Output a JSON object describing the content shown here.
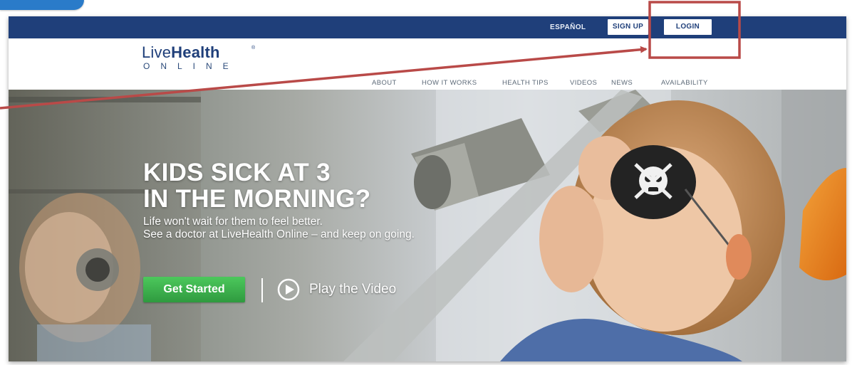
{
  "utility": {
    "espanol": "ESPAÑOL",
    "signup": "SIGN UP",
    "login": "LOGIN"
  },
  "logo": {
    "live": "Live",
    "health": "Health",
    "online": "ONLINE",
    "tm": "®"
  },
  "nav": {
    "items": [
      {
        "label": "ABOUT"
      },
      {
        "label": "HOW IT WORKS"
      },
      {
        "label": "HEALTH TIPS"
      },
      {
        "label": "VIDEOS"
      },
      {
        "label": "NEWS"
      },
      {
        "label": "AVAILABILITY"
      }
    ]
  },
  "hero": {
    "headline_line1": "KIDS SICK AT 3",
    "headline_line2": "IN THE MORNING?",
    "subline1": "Life won't wait for them to feel better.",
    "subline2": "See a doctor at LiveHealth Online – and keep on going.",
    "cta_label": "Get Started",
    "video_label": "Play the Video"
  },
  "annotation": {
    "color": "#b94a48",
    "target": "login-button"
  },
  "colors": {
    "brand_navy": "#1f3f7a",
    "cta_green": "#38a848",
    "corner_tab": "#2a7bc9"
  }
}
